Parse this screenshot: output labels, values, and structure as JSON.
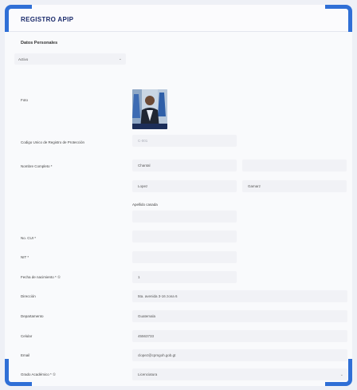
{
  "header": {
    "title": "REGISTRO APIP"
  },
  "form": {
    "section_title": "Datos Personales",
    "status_select": "Activo",
    "labels": {
      "foto": "Foto",
      "codigo": "Codigo Unico de Registro de Protección",
      "nombre": "Nombre Completo *",
      "apellido_casada": "Apellido casada",
      "cui": "No. CUI *",
      "nit": "NIT *",
      "fecha": "Fecha de nacimiento * ①",
      "direccion": "Dirección",
      "departamento": "Departamento",
      "celular": "Celular",
      "email": "Email",
      "grado": "Grado Académico * ①"
    },
    "values": {
      "codigo_placeholder": "C-001",
      "primer_nombre": "Chantal",
      "segundo_nombre": "",
      "primer_apellido": "Lopez",
      "segundo_apellido": "Gamarz",
      "apellido_casada": "",
      "cui": "",
      "nit": "",
      "fecha": "1",
      "direccion": "5ta. avenida 3-16 zona 6",
      "departamento": "Guatemala",
      "celular": "45563733",
      "email": "clopez@cpmgoh.gob.gt",
      "grado": "Licenciatura"
    }
  },
  "colors": {
    "accent": "#2f6fd6",
    "title": "#1a2a6b"
  }
}
